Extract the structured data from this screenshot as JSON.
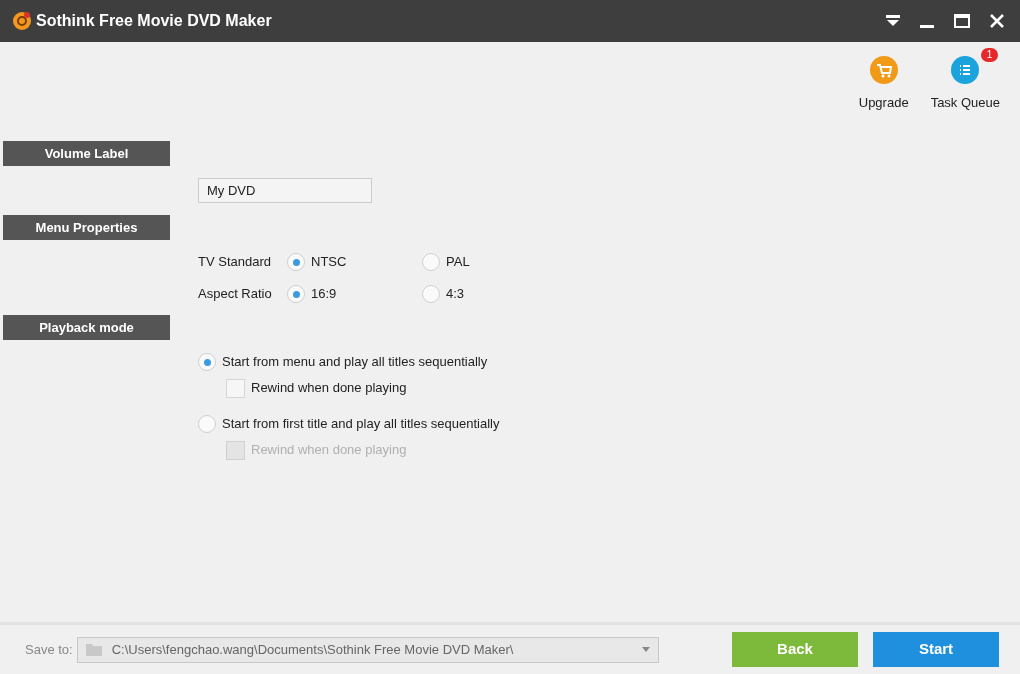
{
  "window": {
    "title": "Sothink Free Movie DVD Maker"
  },
  "toolbar": [
    {
      "kind": "upgrade",
      "label": "Upgrade"
    },
    {
      "kind": "queue",
      "label": "Task Queue",
      "badge": "1"
    }
  ],
  "volume_label": {
    "heading": "Volume Label",
    "value": "My DVD"
  },
  "menu_properties": {
    "heading": "Menu Properties",
    "rows": [
      {
        "label": "TV Standard",
        "options": [
          {
            "label": "NTSC",
            "selected": true
          },
          {
            "label": "PAL",
            "selected": false
          }
        ]
      },
      {
        "label": "Aspect Ratio",
        "options": [
          {
            "label": "16:9",
            "selected": true
          },
          {
            "label": "4:3",
            "selected": false
          }
        ]
      }
    ]
  },
  "playback_mode": {
    "heading": "Playback mode",
    "options": [
      {
        "label": "Start from menu and play all titles sequentially",
        "selected": true,
        "rewind": {
          "label": "Rewind when done playing",
          "checked": false,
          "disabled": false
        }
      },
      {
        "label": "Start from first title and play all titles sequentially",
        "selected": false,
        "rewind": {
          "label": "Rewind when done playing",
          "checked": false,
          "disabled": true
        }
      }
    ]
  },
  "footer": {
    "save_to_label": "Save to:",
    "path": "C:\\Users\\fengchao.wang\\Documents\\Sothink Free Movie DVD Maker\\",
    "buttons": [
      {
        "kind": "back",
        "label": "Back"
      },
      {
        "kind": "start",
        "label": "Start"
      }
    ]
  }
}
